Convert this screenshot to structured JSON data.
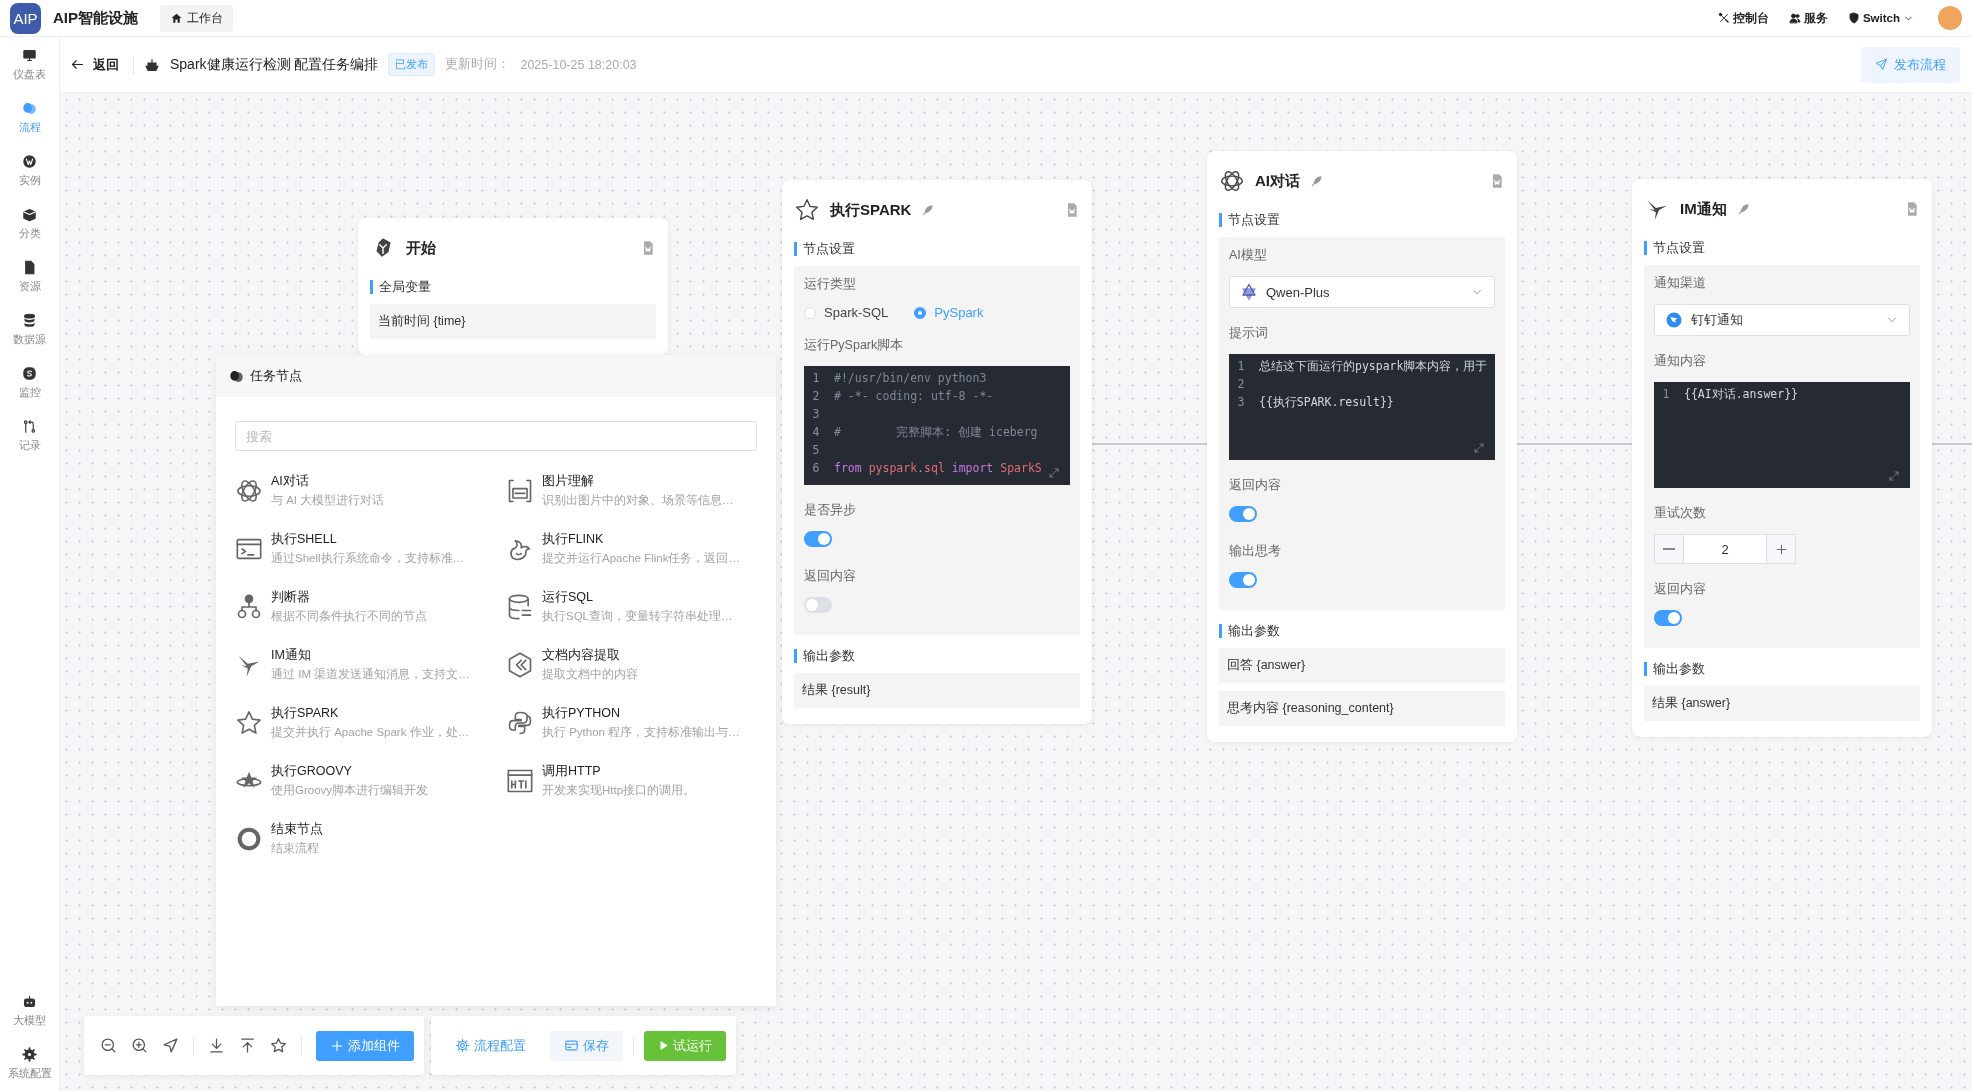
{
  "app": {
    "logo": "AIP",
    "title": "AIP智能设施",
    "tab": "工作台"
  },
  "header_actions": [
    {
      "label": "控制台",
      "kind": "tools"
    },
    {
      "label": "服务",
      "kind": "users"
    },
    {
      "label": "Switch",
      "kind": "shield"
    }
  ],
  "sidebar": {
    "items": [
      {
        "label": "仪盘表",
        "kind": "monitor",
        "selected": false
      },
      {
        "label": "流程",
        "kind": "masks",
        "selected": true
      },
      {
        "label": "实例",
        "kind": "globe",
        "selected": false
      },
      {
        "label": "分类",
        "kind": "box",
        "selected": false
      },
      {
        "label": "资源",
        "kind": "file",
        "selected": false
      },
      {
        "label": "数据源",
        "kind": "database",
        "selected": false
      },
      {
        "label": "监控",
        "kind": "badge",
        "selected": false
      },
      {
        "label": "记录",
        "kind": "branch",
        "selected": false
      }
    ],
    "bottom_items": [
      {
        "label": "大模型",
        "kind": "robot",
        "selected": false
      },
      {
        "label": "系统配置",
        "kind": "gear",
        "selected": false
      }
    ]
  },
  "subheader": {
    "back": "返回",
    "title": "Spark健康运行检测 配置任务编排",
    "badge": "已发布",
    "updated_label": "更新时间：",
    "updated_value": "2025-10-25 18:20:03",
    "publish": "发布流程"
  },
  "nodes": [
    {
      "kind": "start",
      "title": "开始",
      "sections": [
        {
          "title": "全局变量",
          "kind": "params",
          "items": [
            "当前时间 {time}"
          ]
        }
      ]
    },
    {
      "kind": "spark",
      "title": "执行SPARK",
      "sections": [
        {
          "title": "节点设置",
          "kind": "settings",
          "fields": [
            {
              "kind": "radio",
              "label": "运行类型",
              "options": [
                {
                  "label": "Spark-SQL",
                  "selected": false
                },
                {
                  "label": "PySpark",
                  "selected": true
                }
              ]
            },
            {
              "kind": "code",
              "label": "运行PySpark脚本",
              "lines": [
                {
                  "no": "1",
                  "tokens": [
                    {
                      "text": "#!/usr/bin/env python3",
                      "kind": "comment"
                    }
                  ]
                },
                {
                  "no": "2",
                  "tokens": [
                    {
                      "text": "# -*- coding: utf-8 -*-",
                      "kind": "comment"
                    }
                  ]
                },
                {
                  "no": "3"
                },
                {
                  "no": "4",
                  "tokens": [
                    {
                      "text": "#        完整脚本: 创建 iceberg",
                      "kind": "comment"
                    }
                  ]
                },
                {
                  "no": "5"
                },
                {
                  "no": "6",
                  "tokens": [
                    {
                      "text": "from ",
                      "kind": "keyword"
                    },
                    {
                      "text": "pyspark",
                      "kind": "module"
                    },
                    {
                      "text": ".",
                      "kind": "punct"
                    },
                    {
                      "text": "sql ",
                      "kind": "module"
                    },
                    {
                      "text": "import ",
                      "kind": "keyword"
                    },
                    {
                      "text": "SparkS",
                      "kind": "module"
                    }
                  ]
                }
              ]
            },
            {
              "kind": "toggle",
              "label": "是否异步",
              "on": true
            },
            {
              "kind": "toggle",
              "label": "返回内容",
              "on": false
            }
          ]
        },
        {
          "title": "输出参数",
          "kind": "params",
          "items": [
            "结果 {result}"
          ]
        }
      ]
    },
    {
      "kind": "ai",
      "title": "AI对话",
      "sections": [
        {
          "title": "节点设置",
          "kind": "settings",
          "fields": [
            {
              "kind": "select",
              "label": "AI模型",
              "value": "Qwen-Plus"
            },
            {
              "kind": "code",
              "label": "提示词",
              "lines": [
                {
                  "no": "1",
                  "tokens": [
                    {
                      "text": "总结这下面运行的pyspark脚本内容，用于",
                      "kind": "text"
                    }
                  ]
                },
                {
                  "no": "2"
                },
                {
                  "no": "3",
                  "tokens": [
                    {
                      "text": "{{执行SPARK.result}}",
                      "kind": "text"
                    }
                  ]
                }
              ]
            },
            {
              "kind": "toggle",
              "label": "返回内容",
              "on": true
            },
            {
              "kind": "toggle",
              "label": "输出思考",
              "on": true
            }
          ]
        },
        {
          "title": "输出参数",
          "kind": "params",
          "items": [
            "回答 {answer}",
            "思考内容 {reasoning_content}"
          ]
        }
      ]
    },
    {
      "kind": "im",
      "title": "IM通知",
      "sections": [
        {
          "title": "节点设置",
          "kind": "settings",
          "fields": [
            {
              "kind": "select",
              "label": "通知渠道",
              "value": "钉钉通知"
            },
            {
              "kind": "code",
              "label": "通知内容",
              "lines": [
                {
                  "no": "1",
                  "tokens": [
                    {
                      "text": "{{AI对话.answer}}",
                      "kind": "text"
                    }
                  ]
                }
              ]
            },
            {
              "kind": "stepper",
              "label": "重试次数",
              "value": "2"
            },
            {
              "kind": "toggle",
              "label": "返回内容",
              "on": true
            }
          ]
        },
        {
          "title": "输出参数",
          "kind": "params",
          "items": [
            "结果 {answer}"
          ]
        }
      ]
    }
  ],
  "task_panel": {
    "title": "任务节点",
    "search": {
      "placeholder": "搜索"
    },
    "items": [
      {
        "kind": "ai",
        "title": "AI对话",
        "description": "与 AI 大模型进行对话"
      },
      {
        "kind": "image",
        "title": "图片理解",
        "description": "识别出图片中的对象、场景等信息…"
      },
      {
        "kind": "shell",
        "title": "执行SHELL",
        "description": "通过Shell执行系统命令，支持标准…"
      },
      {
        "kind": "flink",
        "title": "执行FLINK",
        "description": "提交并运行Apache Flink任务，返回…"
      },
      {
        "kind": "condition",
        "title": "判断器",
        "description": "根据不同条件执行不同的节点"
      },
      {
        "kind": "sql",
        "title": "运行SQL",
        "description": "执行SQL查询，变量转字符串处理…"
      },
      {
        "kind": "im",
        "title": "IM通知",
        "description": "通过 IM 渠道发送通知消息，支持文…"
      },
      {
        "kind": "document",
        "title": "文档内容提取",
        "description": "提取文档中的内容"
      },
      {
        "kind": "spark",
        "title": "执行SPARK",
        "description": "提交并执行 Apache Spark 作业，处…"
      },
      {
        "kind": "python",
        "title": "执行PYTHON",
        "description": "执行 Python 程序，支持标准输出与…"
      },
      {
        "kind": "groovy",
        "title": "执行GROOVY",
        "description": "使用Groovy脚本进行编辑开发"
      },
      {
        "kind": "http",
        "title": "调用HTTP",
        "description": "开发来实现Http接口的调用。"
      },
      {
        "kind": "end",
        "title": "结束节点",
        "description": "结束流程"
      }
    ]
  },
  "toolbar": {
    "tools": [
      {
        "kind": "zoom-out"
      },
      {
        "kind": "zoom-in"
      },
      {
        "kind": "locate"
      },
      {
        "kind": "download"
      },
      {
        "kind": "upload"
      },
      {
        "kind": "star"
      }
    ],
    "add": "添加组件",
    "config": "流程配置",
    "save": "保存",
    "run": "试运行"
  }
}
